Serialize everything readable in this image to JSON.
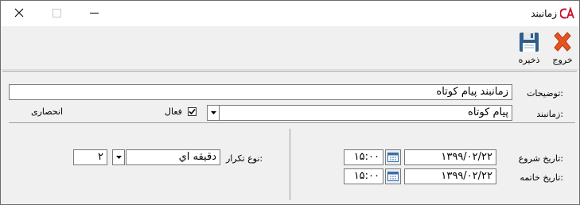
{
  "window": {
    "title": "زمانبند",
    "app_icon": "ca-logo-icon"
  },
  "toolbar": {
    "exit_label": "خروج",
    "save_label": "ذخیره"
  },
  "form": {
    "description_label": "توضیحات:",
    "description_value": "زمانبند پیام کوتاه",
    "scheduler_label": "زمانبند:",
    "scheduler_value": "پیام کوتاه",
    "active_label": "فعال",
    "active_checked": true,
    "exclusive_label": "انحصاری",
    "start_date_label": "تاریخ شروع:",
    "start_date_value": "۱۳۹۹/۰۲/۲۲",
    "start_time_value": "۱۵:۰۰",
    "end_date_label": "تاریخ خاتمه:",
    "end_date_value": "۱۳۹۹/۰۲/۲۲",
    "end_time_value": "۱۵:۰۰",
    "repeat_type_label": "نوع تکرار:",
    "repeat_type_value": "دقیقه اي",
    "repeat_count_value": "۲"
  },
  "colors": {
    "exit_x": "#e8521e",
    "save_disk": "#2f5f8a",
    "logo_red": "#c8102e"
  }
}
